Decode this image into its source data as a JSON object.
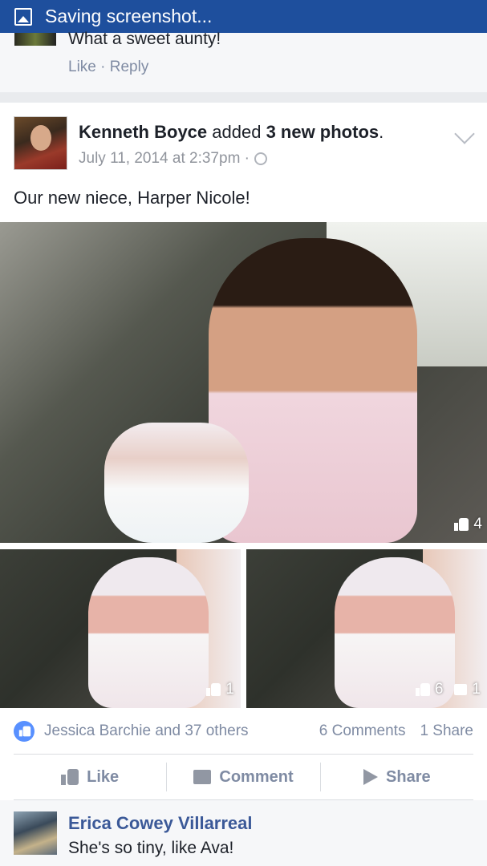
{
  "statusbar": {
    "text": "Saving screenshot..."
  },
  "previous_comment": {
    "text": "What a sweet aunty!",
    "actions": "Like · Reply"
  },
  "post": {
    "author": "Kenneth Boyce",
    "action_prefix": " added ",
    "action_bold": "3 new photos",
    "action_suffix": ".",
    "timestamp": "July 11, 2014 at 2:37pm ·",
    "caption": "Our new niece, Harper Nicole!",
    "photos": [
      {
        "likes": "4"
      },
      {
        "likes": "1"
      },
      {
        "likes": "6",
        "comments": "1"
      }
    ],
    "reactions_text": "Jessica Barchie and 37 others",
    "comments_count": "6 Comments",
    "shares_count": "1 Share",
    "actions": {
      "like": "Like",
      "comment": "Comment",
      "share": "Share"
    }
  },
  "comment": {
    "author": "Erica Cowey Villarreal",
    "text": "She's so tiny, like Ava!"
  },
  "colors": {
    "statusbar": "#1e4f9d",
    "link": "#3b5998",
    "like_blue": "#5890ff"
  }
}
